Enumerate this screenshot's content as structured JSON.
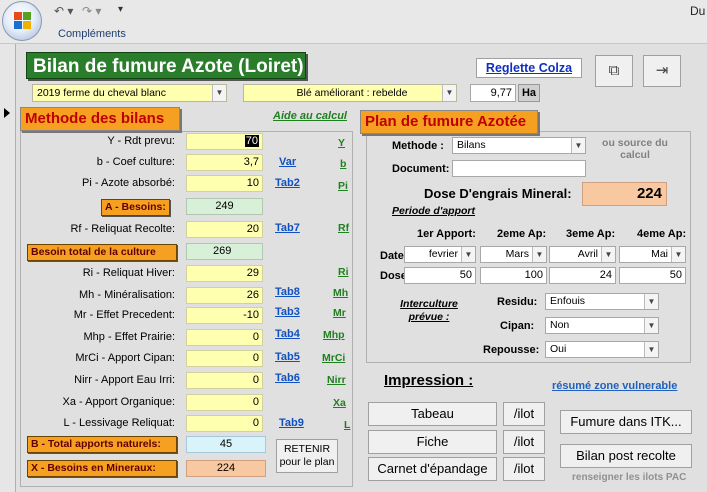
{
  "ribbon": {
    "tab": "Compléments",
    "title": "Du",
    "undo_icon": "undo-icon",
    "redo_icon": "redo-icon"
  },
  "header": {
    "title": "Bilan de fumure Azote (Loiret)",
    "link_colza": "Reglette Colza",
    "year_farm": "2019  ferme du cheval blanc",
    "crop": "Blé améliorant : rebelde",
    "area_value": "9,77",
    "area_unit": "Ha"
  },
  "left": {
    "heading": "Methode des bilans",
    "aide": "Aide au calcul",
    "rows": [
      {
        "label": "Y - Rdt prevu:",
        "value": "70",
        "tab": "",
        "col": "Y"
      },
      {
        "label": "b - Coef culture:",
        "value": "3,7",
        "tab": "Var",
        "col": "b"
      },
      {
        "label": "Pi - Azote absorbé:",
        "value": "10",
        "tab": "Tab2",
        "col": "Pi"
      },
      {
        "label": "A - Besoins:",
        "value": "249",
        "tab": "",
        "col": ""
      },
      {
        "label": "Rf - Reliquat Recolte:",
        "value": "20",
        "tab": "Tab7",
        "col": "Rf"
      },
      {
        "label": "Besoin total de la culture",
        "value": "269",
        "tab": "",
        "col": ""
      },
      {
        "label": "Ri - Reliquat Hiver:",
        "value": "29",
        "tab": "",
        "col": "Ri"
      },
      {
        "label": "Mh - Minéralisation:",
        "value": "26",
        "tab": "Tab8",
        "col": "Mh"
      },
      {
        "label": "Mr - Effet Precedent:",
        "value": "-10",
        "tab": "Tab3",
        "col": "Mr"
      },
      {
        "label": "Mhp - Effet Prairie:",
        "value": "0",
        "tab": "Tab4",
        "col": "Mhp"
      },
      {
        "label": "MrCi - Apport Cipan:",
        "value": "0",
        "tab": "Tab5",
        "col": "MrCi"
      },
      {
        "label": "Nirr - Apport Eau Irri:",
        "value": "0",
        "tab": "Tab6",
        "col": "Nirr"
      },
      {
        "label": "Xa - Apport Organique:",
        "value": "0",
        "tab": "",
        "col": "Xa"
      },
      {
        "label": "L - Lessivage Reliquat:",
        "value": "0",
        "tab": "Tab9",
        "col": "L"
      },
      {
        "label": "B - Total apports naturels:",
        "value": "45",
        "tab": "",
        "col": ""
      },
      {
        "label": "X - Besoins en Mineraux:",
        "value": "224",
        "tab": "",
        "col": ""
      }
    ],
    "retenir": "RETENIR",
    "retenir2": "pour le plan"
  },
  "right": {
    "heading": "Plan de fumure Azotée",
    "methode_label": "Methode :",
    "methode_value": "Bilans",
    "ou_source": "ou source du calcul",
    "document_label": "Document:",
    "document_value": "",
    "dose_label": "Dose D'engrais Mineral:",
    "dose_value": "224",
    "periode": "Periode d'apport",
    "apports": [
      {
        "head": "1er Apport:",
        "date": "fevrier",
        "dose": "50"
      },
      {
        "head": "2eme Ap:",
        "date": "Mars",
        "dose": "100"
      },
      {
        "head": "3eme Ap:",
        "date": "Avril",
        "dose": "24"
      },
      {
        "head": "4eme Ap:",
        "date": "Mai",
        "dose": "50"
      }
    ],
    "date_label": "Date",
    "dose_row_label": "Dose:",
    "interculture": "Interculture prévue :",
    "residu_label": "Residu:",
    "residu_value": "Enfouis",
    "cipan_label": "Cipan:",
    "cipan_value": "Non",
    "repousse_label": "Repousse:",
    "repousse_value": "Oui"
  },
  "impression": {
    "title": "Impression :",
    "resume": "résumé zone vulnerable",
    "tabeau": "Tabeau",
    "fiche": "Fiche",
    "carnet": "Carnet d'épandage",
    "ilot": "/ilot",
    "itk": "Fumure dans ITK...",
    "post": "Bilan post recolte",
    "renseigner": "renseigner les ilots PAC"
  }
}
